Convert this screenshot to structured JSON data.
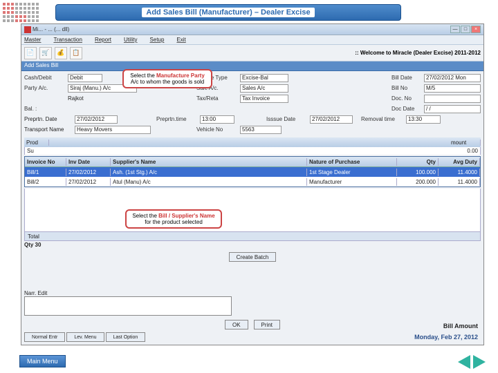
{
  "banner": {
    "title": "Add Sales Bill (Manufacturer) – Dealer Excise"
  },
  "window": {
    "title": "Mi... - ... (... dll)",
    "min": "—",
    "max": "□",
    "close": "×"
  },
  "menu": {
    "items": [
      "Master",
      "Transaction",
      "Report",
      "Utility",
      "Setup",
      "Exit"
    ]
  },
  "toolbar": {
    "icons": [
      "📄",
      "🛒",
      "💰",
      "📋"
    ],
    "welcome": ":: Welcome to Miracle (Dealer Excise) 2011-2012"
  },
  "breadcrumb": "Add Sales Bill",
  "callouts": {
    "c1_pre": "Select the ",
    "c1_b": "Manufacture Party",
    "c1_post": " A/c to whom the goods is sold",
    "c2_pre": "Select the ",
    "c2_b": "Bill / Supplier's Name",
    "c2_post": " for the product selected"
  },
  "form": {
    "cash_debit_lbl": "Cash/Debit",
    "cash_debit_val": "Debit",
    "invoice_type_lbl": "Invoice Type",
    "invoice_type_val": "Excise-Bal",
    "bill_date_lbl": "Bill Date",
    "bill_date_val": "27/02/2012  Mon",
    "party_lbl": "Party A/c.",
    "party_val": "Siraj (Manu.) A/c",
    "sale_ac_lbl": "Sale A/c.",
    "sale_ac_val": "Sales A/c",
    "bill_no_lbl": "Bill No",
    "bill_no_val": "M/5",
    "city_blank_lbl": "",
    "city_val": "Rajkot",
    "tax_lbl": "Tax/Reta",
    "tax_val": "Tax Invoice",
    "doc_no_lbl": "Doc. No",
    "bal_lbl": "Bal. :",
    "doc_date_lbl": "Doc Date",
    "doc_date_val": "/ /",
    "prep_date_lbl": "Preprtn. Date",
    "prep_date_val": "27/02/2012",
    "prep_time_lbl": "Preprtn.time",
    "prep_time_val": "13:00",
    "issue_date_lbl": "Isssue Date",
    "issue_date_val": "27/02/2012",
    "removal_time_lbl": "Removal time",
    "removal_time_val": "13:30",
    "transport_lbl": "Transport Name",
    "transport_val": "Heavy Movers",
    "vehicle_lbl": "Vehicle No",
    "vehicle_val": "5563"
  },
  "prodhead": {
    "c1": "Prod",
    "c2": "",
    "c3": "mount"
  },
  "substrip": "Su",
  "grid": {
    "headers": {
      "inv": "Invoice No",
      "date": "Inv Date",
      "sup": "Supplier's Name",
      "nat": "Nature of Purchase",
      "qty": "Qty",
      "duty": "Avg Duty"
    },
    "row1": {
      "inv": "Bill/1",
      "date": "27/02/2012",
      "sup": "Ash. (1st Stg.) A/c",
      "nat": "1st Stage Dealer",
      "qty": "100.000",
      "duty": "11.4000"
    },
    "row2": {
      "inv": "Bill/2",
      "date": "27/02/2012",
      "sup": "Atul (Manu) A/c",
      "nat": "Manufacturer",
      "qty": "200.000",
      "duty": "11.4000"
    },
    "sideval": "0.00"
  },
  "totals": {
    "lbl": "Total"
  },
  "qty": "Qty 30",
  "create_batch": "Create Batch",
  "narration_lbl": "Narr. Edit",
  "ok": "OK",
  "print": "Print",
  "bill_amount": "Bill Amount",
  "datefoot": "Monday, Feb 27, 2012",
  "bottom": {
    "b1": "Normal Entr",
    "b2": "Lev. Menu",
    "b3": "Last Option"
  },
  "mainmenu": "Main Menu"
}
